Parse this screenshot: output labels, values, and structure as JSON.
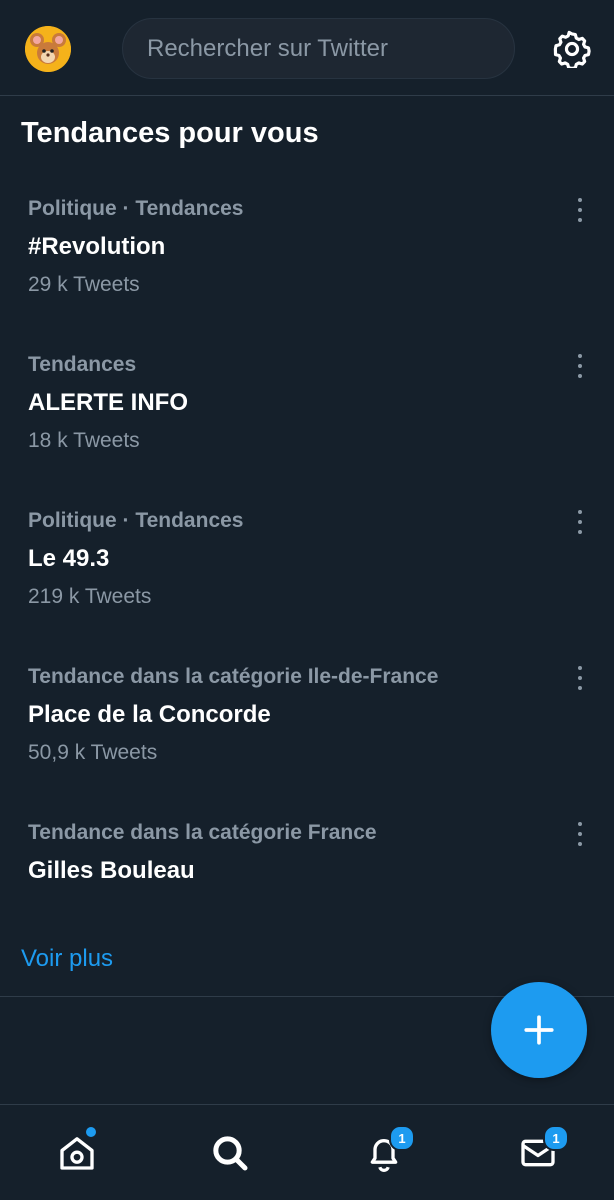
{
  "search": {
    "placeholder": "Rechercher sur Twitter"
  },
  "section": {
    "title": "Tendances pour vous"
  },
  "trends": [
    {
      "category": "Politique · Tendances",
      "name": "#Revolution",
      "count": "29 k Tweets"
    },
    {
      "category": "Tendances",
      "name": "ALERTE INFO",
      "count": "18 k Tweets"
    },
    {
      "category": "Politique · Tendances",
      "name": "Le 49.3",
      "count": "219 k Tweets"
    },
    {
      "category": "Tendance dans la catégorie Ile-de-France",
      "name": "Place de la Concorde",
      "count": "50,9 k Tweets"
    },
    {
      "category": "Tendance dans la catégorie France",
      "name": "Gilles Bouleau",
      "count": ""
    }
  ],
  "see_more": "Voir plus",
  "nav": {
    "notifications_badge": "1",
    "messages_badge": "1"
  },
  "colors": {
    "background": "#15202b",
    "accent": "#1d9bf0",
    "secondary_text": "#8b98a5",
    "divider": "#2f3c49"
  },
  "icons": {
    "avatar": "avatar-mouse",
    "settings": "gear-icon",
    "more": "more-vertical-icon",
    "compose": "plus-icon",
    "home": "home-icon",
    "explore": "search-icon",
    "notifications": "bell-icon",
    "messages": "mail-icon"
  }
}
